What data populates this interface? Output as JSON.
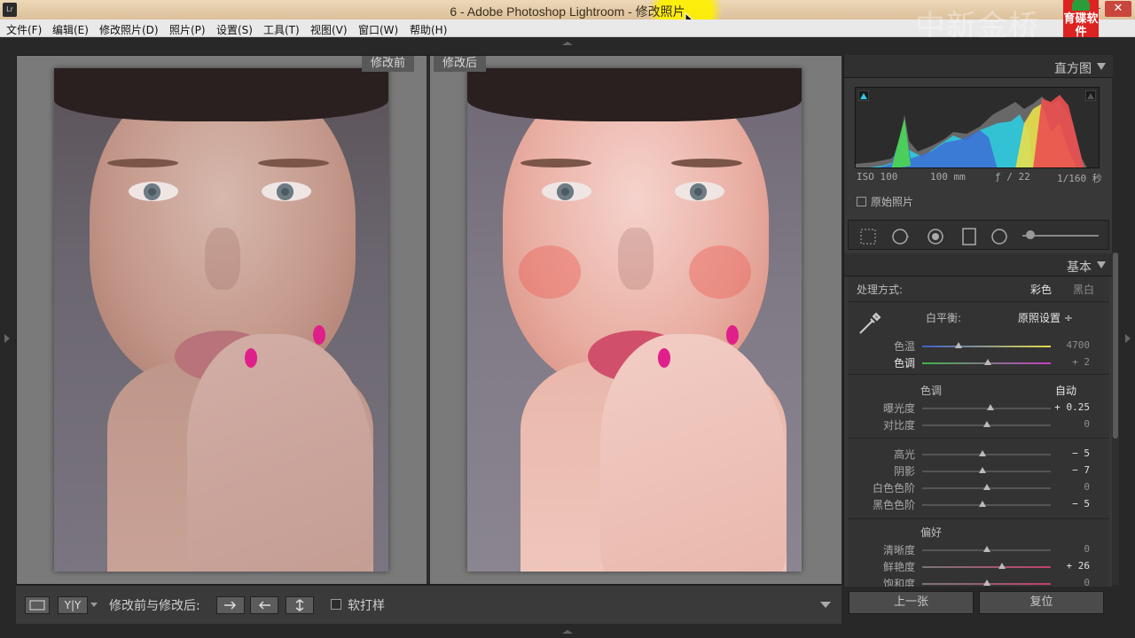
{
  "window": {
    "title": "6 - Adobe Photoshop Lightroom - 修改照片",
    "app_icon": "Lr",
    "minimize": "—",
    "close": "✕"
  },
  "watermark": {
    "text": "中新金桥",
    "logo_text": "育碟软件"
  },
  "menu": [
    "文件(F)",
    "编辑(E)",
    "修改照片(D)",
    "照片(P)",
    "设置(S)",
    "工具(T)",
    "视图(V)",
    "窗口(W)",
    "帮助(H)"
  ],
  "compare": {
    "before_label": "修改前",
    "after_label": "修改后"
  },
  "toolbar": {
    "yy_label": "Y|Y",
    "before_after_label": "修改前与修改后:",
    "soft_proof_label": "软打样"
  },
  "panel": {
    "histogram_title": "直方图",
    "histogram_info": {
      "iso": "ISO 100",
      "focal": "100 mm",
      "aperture": "ƒ / 22",
      "shutter": "1/160 秒"
    },
    "original_photo_label": "原始照片",
    "basic_title": "基本",
    "treatment_label": "处理方式:",
    "treatment_color": "彩色",
    "treatment_bw": "黑白",
    "wb_label": "白平衡:",
    "wb_value": "原照设置 ÷",
    "tone_label": "色调",
    "tone_auto": "自动",
    "presence_label": "偏好",
    "sliders": {
      "temp": {
        "label": "色温",
        "value": "4700",
        "pos": 0.28
      },
      "tint": {
        "label": "色调",
        "value": "+ 2",
        "pos": 0.51
      },
      "exposure": {
        "label": "曝光度",
        "value": "+ 0.25",
        "pos": 0.53
      },
      "contrast": {
        "label": "对比度",
        "value": "0",
        "pos": 0.5
      },
      "highlights": {
        "label": "高光",
        "value": "− 5",
        "pos": 0.47
      },
      "shadows": {
        "label": "阴影",
        "value": "− 7",
        "pos": 0.47
      },
      "whites": {
        "label": "白色色阶",
        "value": "0",
        "pos": 0.5
      },
      "blacks": {
        "label": "黑色色阶",
        "value": "− 5",
        "pos": 0.47
      },
      "clarity": {
        "label": "清晰度",
        "value": "0",
        "pos": 0.5
      },
      "vibrance": {
        "label": "鲜艳度",
        "value": "+ 26",
        "pos": 0.62
      },
      "saturation": {
        "label": "饱和度",
        "value": "0",
        "pos": 0.5
      }
    },
    "prev_label": "上一张",
    "reset_label": "复位"
  },
  "colors": {
    "panel_bg": "#383838",
    "title_bar": "#e4cba7",
    "menu_bg": "#e9e9e9",
    "accent_pink": "#e0208a"
  }
}
